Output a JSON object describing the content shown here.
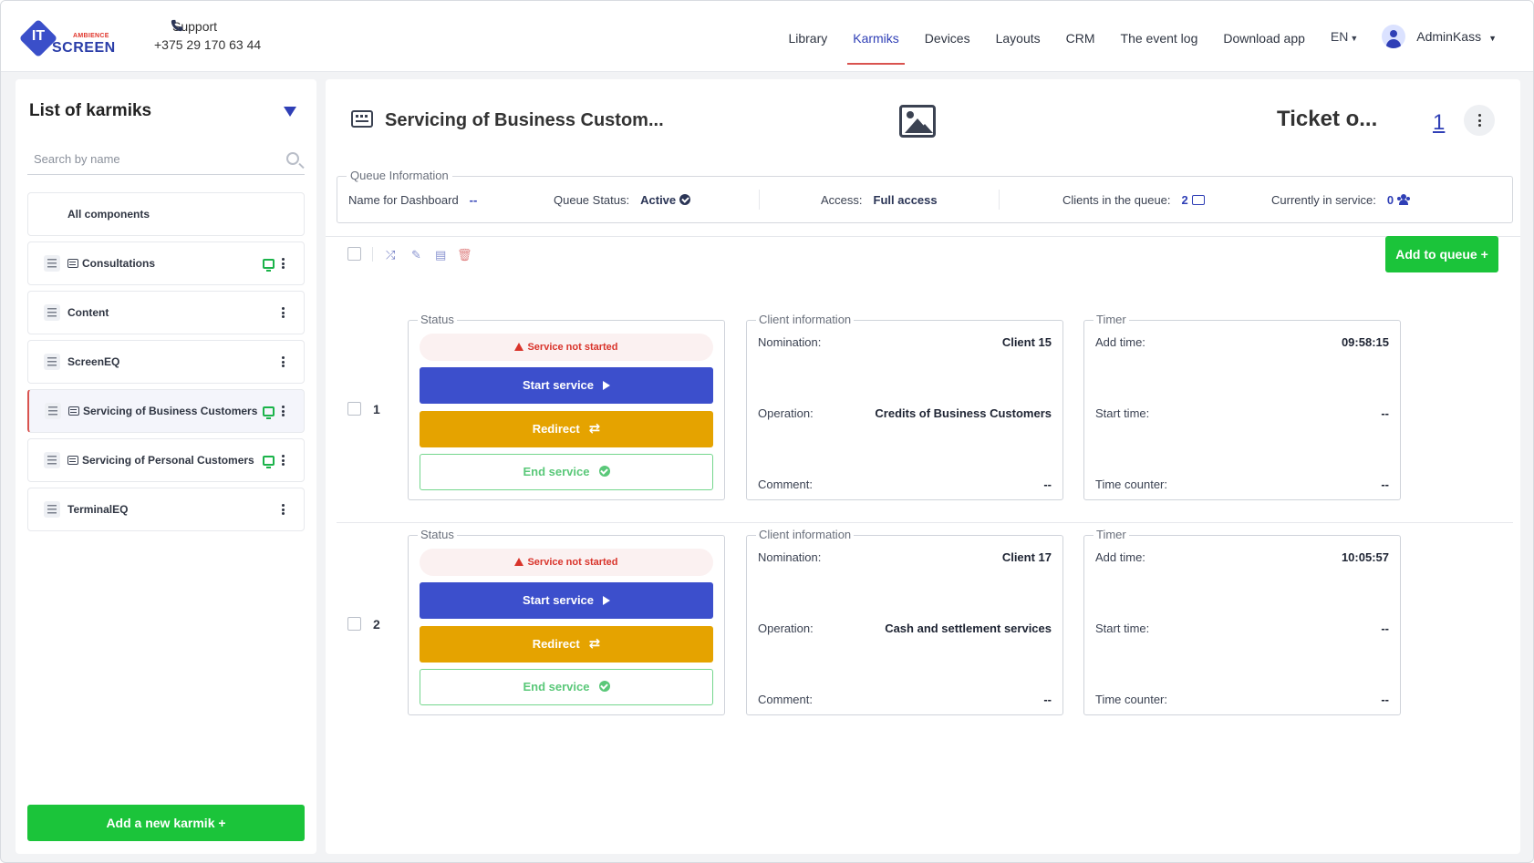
{
  "header": {
    "logo": {
      "it": "IT",
      "ambience": "AMBIENCE",
      "screen": "SCREEN"
    },
    "support": {
      "label": "Support",
      "phone": "+375 29 170 63 44"
    },
    "nav": [
      "Library",
      "Karmiks",
      "Devices",
      "Layouts",
      "CRM",
      "The event log",
      "Download app"
    ],
    "active_nav": "Karmiks",
    "lang": "EN",
    "user": "AdminKass"
  },
  "sidebar": {
    "title": "List of karmiks",
    "search_placeholder": "Search by name",
    "all_components": "All components",
    "items": [
      {
        "label": "Consultations",
        "has_screen_icon": true,
        "online": true
      },
      {
        "label": "Content",
        "has_screen_icon": false,
        "online": false
      },
      {
        "label": "ScreenEQ",
        "has_screen_icon": false,
        "online": false
      },
      {
        "label": "Servicing of Business Customers",
        "has_screen_icon": true,
        "online": true,
        "selected": true
      },
      {
        "label": "Servicing of Personal Customers",
        "has_screen_icon": true,
        "online": true
      },
      {
        "label": "TerminalEQ",
        "has_screen_icon": false,
        "online": false
      }
    ],
    "add_button": "Add a new karmik +"
  },
  "main": {
    "title": "Servicing of Business Custom...",
    "ticket_label": "Ticket o...",
    "ticket_number": "1",
    "queue_info": {
      "legend": "Queue Information",
      "name_label": "Name for Dashboard",
      "name_value": "--",
      "status_label": "Queue Status:",
      "status_value": "Active",
      "access_label": "Access:",
      "access_value": "Full access",
      "clients_label": "Clients in the queue:",
      "clients_value": "2",
      "service_label": "Currently in service:",
      "service_value": "0"
    },
    "add_to_queue": "Add to queue +",
    "rows": [
      {
        "num": "1",
        "status_legend": "Status",
        "status": "Service not started",
        "start": "Start service",
        "redirect": "Redirect",
        "end": "End service",
        "client_legend": "Client information",
        "nomination_label": "Nomination:",
        "nomination": "Client 15",
        "operation_label": "Operation:",
        "operation": "Credits of Business Customers",
        "comment_label": "Comment:",
        "comment": "--",
        "timer_legend": "Timer",
        "add_time_label": "Add time:",
        "add_time": "09:58:15",
        "start_time_label": "Start time:",
        "start_time": "--",
        "counter_label": "Time counter:",
        "counter": "--"
      },
      {
        "num": "2",
        "status_legend": "Status",
        "status": "Service not started",
        "start": "Start service",
        "redirect": "Redirect",
        "end": "End service",
        "client_legend": "Client information",
        "nomination_label": "Nomination:",
        "nomination": "Client 17",
        "operation_label": "Operation:",
        "operation": "Cash and settlement services",
        "comment_label": "Comment:",
        "comment": "--",
        "timer_legend": "Timer",
        "add_time_label": "Add time:",
        "add_time": "10:05:57",
        "start_time_label": "Start time:",
        "start_time": "--",
        "counter_label": "Time counter:",
        "counter": "--"
      }
    ]
  },
  "colors": {
    "accent": "#2f3fb6",
    "start": "#3c4fcc",
    "redirect": "#e5a300",
    "success": "#1bc43a",
    "danger": "#d9342b"
  }
}
